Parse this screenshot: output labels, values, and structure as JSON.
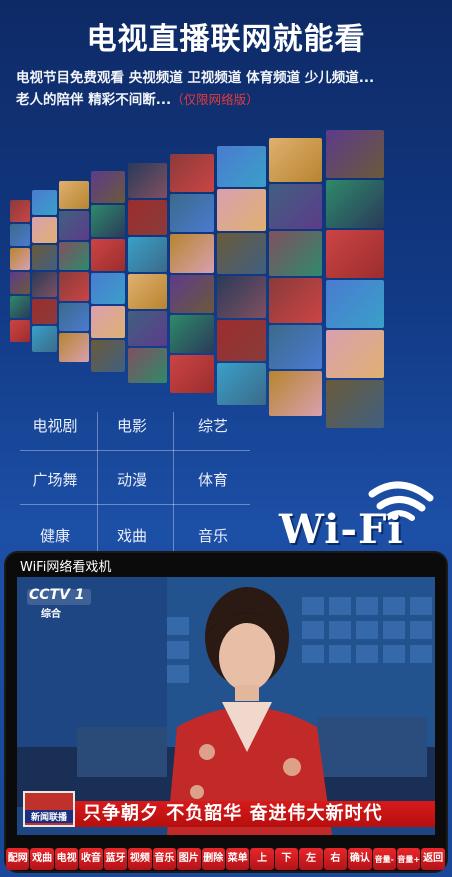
{
  "promo": {
    "headline": "电视直播联网就能看",
    "subtitle_line1": "电视节目免费观看 央视频道 卫视频道 体育频道 少儿频道...",
    "subtitle_line2": "老人的陪伴 精彩不间断...",
    "subtitle_limited": "（仅限网络版）"
  },
  "categories": [
    {
      "label": "电视剧"
    },
    {
      "label": "电影"
    },
    {
      "label": "综艺"
    },
    {
      "label": "广场舞"
    },
    {
      "label": "动漫"
    },
    {
      "label": "体育"
    },
    {
      "label": "健康"
    },
    {
      "label": "戏曲"
    },
    {
      "label": "音乐"
    }
  ],
  "wifi_label": "Wi-Fi",
  "tv": {
    "title": "WiFi网络看戏机",
    "channel_logo": "CCTV 1",
    "channel_sub": "综合",
    "program_logo": "新闻联播",
    "ticker": "只争朝夕 不负韶华 奋进伟大新时代"
  },
  "buttons": [
    {
      "label": "配网"
    },
    {
      "label": "戏曲"
    },
    {
      "label": "电视"
    },
    {
      "label": "收音"
    },
    {
      "label": "蓝牙"
    },
    {
      "label": "视频"
    },
    {
      "label": "音乐"
    },
    {
      "label": "图片"
    },
    {
      "label": "删除"
    },
    {
      "label": "菜单"
    },
    {
      "label": "上"
    },
    {
      "label": "下"
    },
    {
      "label": "左"
    },
    {
      "label": "右"
    },
    {
      "label": "确认"
    },
    {
      "label": "音量-"
    },
    {
      "label": "音量+"
    },
    {
      "label": "返回"
    }
  ],
  "colors": {
    "background_top": "#0e2a66",
    "background_bottom": "#1a4797",
    "accent_red": "#d71a1a",
    "limited_text": "#e23b3b"
  }
}
